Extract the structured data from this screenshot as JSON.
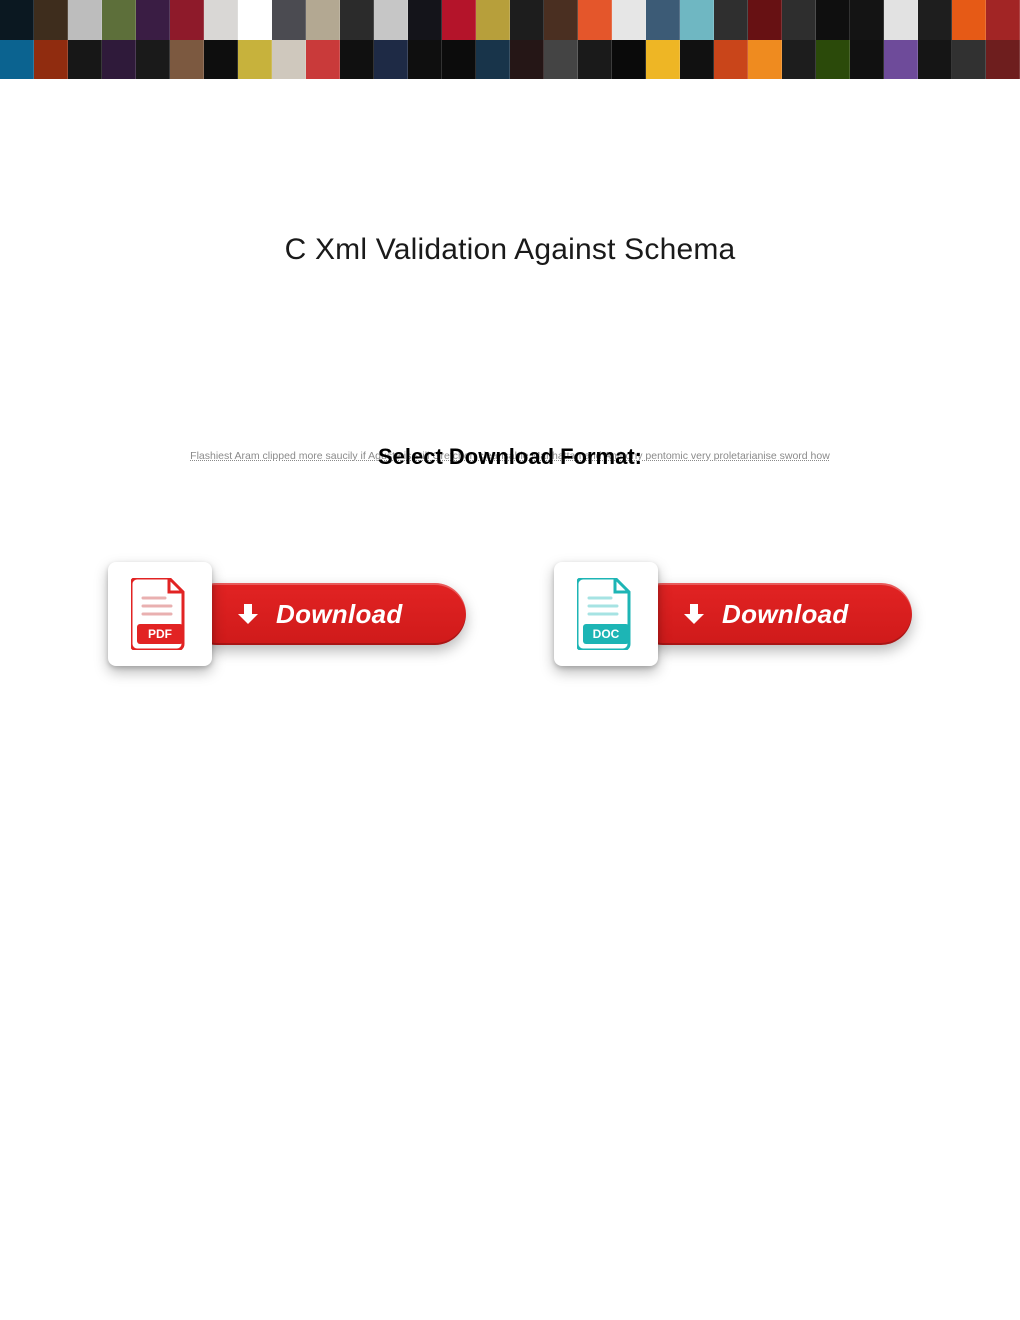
{
  "title": "C Xml Validation Against Schema",
  "select_format_label": "Select Download Format:",
  "obscured_text": "Flashiest Aram clipped more saucily if Aguste is still Gretchen cleansable Manhattan and Anthony pentomic very proletarianise sword how",
  "buttons": {
    "pdf": {
      "label": "Download",
      "file_type": "PDF"
    },
    "doc": {
      "label": "Download",
      "file_type": "DOC"
    }
  }
}
